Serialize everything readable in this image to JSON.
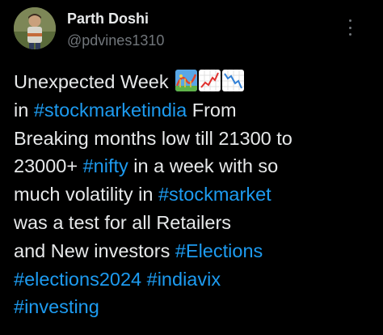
{
  "author": {
    "name": "Parth Doshi",
    "handle": "@pdvines1310",
    "avatar_icon": "profile-avatar"
  },
  "menu": {
    "icon": "more-vertical-icon"
  },
  "tweet": {
    "line1": "Unexpected Week",
    "line1_emojis": [
      "roller-coaster-emoji",
      "chart-increasing-emoji",
      "chart-decreasing-emoji"
    ],
    "line2_tag": "#stockmarketindia",
    "line2_text": " From",
    "line3": "Breaking months low till 21300 to",
    "line4_pre": "23000+ ",
    "line4_tag": "#nifty",
    "line4_post": " in a week with so",
    "line5_pre": "much volatility in ",
    "line5_tag": "#stockmarket",
    "line6": "was a test for all Retailers",
    "line7_pre": "and New investors ",
    "line7_tag": "#Elections",
    "line8_tag1": "#elections2024",
    "line8_tag2": "#indiavix",
    "line9_tag": "#investing"
  },
  "colors": {
    "background": "#000000",
    "text": "#e7e9ea",
    "muted": "#71767b",
    "link": "#1d9bf0"
  }
}
